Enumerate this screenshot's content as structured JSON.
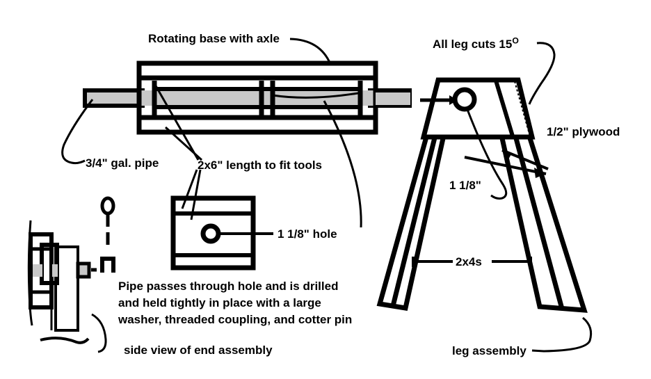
{
  "drawing": {
    "title_context": "sawhorse / rotating tool base woodworking plan",
    "stroke_color": "#000000",
    "pipe_fill_color": "#C8C8C8",
    "background_color": "#FFFFFF"
  },
  "labels": {
    "rotating_base": "Rotating base with axle",
    "all_leg_cuts": "All leg cuts 15",
    "all_leg_cuts_degree": "O",
    "plywood": "1/2\" plywood",
    "gal_pipe": "3/4\" gal. pipe",
    "two_by_six": "2x6\"  length to fit tools",
    "hole_label": "1 1/8\" hole",
    "hole_dim": "1 1/8\"",
    "two_by_fours": "2x4s",
    "leg_assembly": "leg assembly",
    "side_view": "side view of end assembly",
    "note_line_1": "Pipe passes through hole and is drilled",
    "note_line_2": "and held tightly in place with a large",
    "note_line_3": "washer,  threaded coupling, and cotter pin"
  }
}
